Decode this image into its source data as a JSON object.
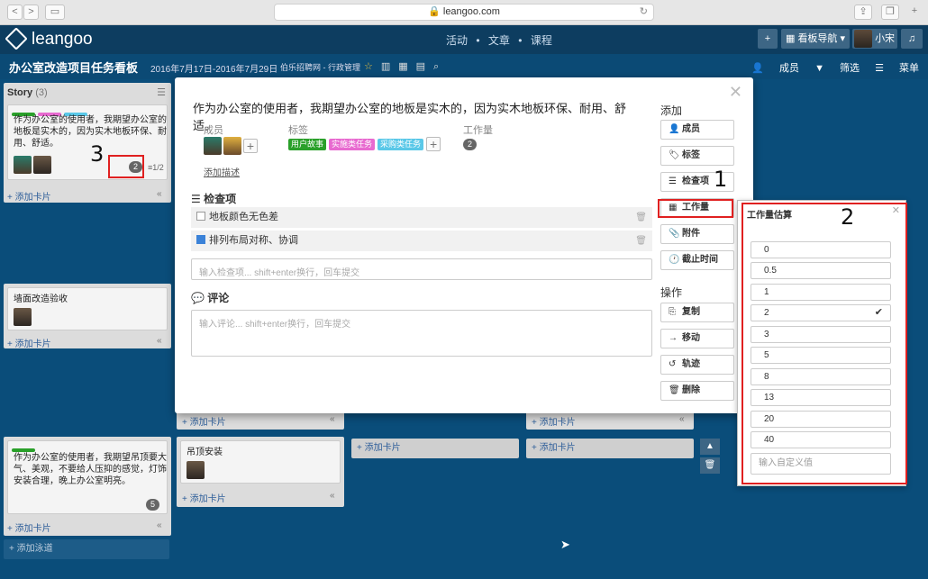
{
  "browser": {
    "url": "leangoo.com",
    "back": "<",
    "forward": ">",
    "reload": "↻"
  },
  "app": {
    "logo": "leangoo",
    "nav": [
      "活动",
      "•",
      "文章",
      "•",
      "课程"
    ],
    "add": "+",
    "board_nav": "看板导航 ▾",
    "user": "小宋",
    "bell": "🔔"
  },
  "board": {
    "title": "办公室改造项目任务看板",
    "dates": "2016年7月17日-2016年7月29日",
    "org": "伯乐招聘网 - 行政管理",
    "star": "☆",
    "tools": "▥▦▤⌕",
    "members": "成员",
    "filter": "筛选",
    "menu": "菜单"
  },
  "columns": {
    "story_title": "Story",
    "story_count": "(3)",
    "card1_text": "作为办公室的使用者，我期望办公室的地板是实木的，因为实木地板环保、耐用、舒适。",
    "card1_badge": "2",
    "card1_check": "≡1/2",
    "card2_text": "墙面改造验收",
    "card3_text": "作为办公室的使用者，我期望吊顶要大气、美观，不要给人压抑的感觉，灯饰安装合理，晚上办公室明亮。",
    "card3_badge": "5",
    "card4_text": "吊顶安装",
    "add_card": "+ 添加卡片",
    "add_lane": "+ 添加泳道",
    "collapse": "«"
  },
  "modal": {
    "title": "作为办公室的使用者，我期望办公室的地板是实木的，因为实木地板环保、耐用、舒适。",
    "close": "✕",
    "members_label": "成员",
    "tags_label": "标签",
    "workload_label": "工作量",
    "workload_value": "2",
    "tags": [
      {
        "text": "用户故事",
        "color": "#2aa02a"
      },
      {
        "text": "实施类任务",
        "color": "#e86ad0"
      },
      {
        "text": "采购类任务",
        "color": "#5ac8e8"
      }
    ],
    "add_desc": "添加描述",
    "checklist_title": "检查项",
    "check_items": [
      "地板颜色无色差",
      "排列布局对称、协调"
    ],
    "check_placeholder": "输入检查项... shift+enter换行，回车提交",
    "comments_title": "评论",
    "comment_placeholder": "输入评论... shift+enter换行，回车提交",
    "side_add": "添加",
    "side_ops": "操作",
    "btn_members": "成员",
    "btn_tags": "标签",
    "btn_checklist": "检查项",
    "btn_workload": "工作量",
    "btn_attach": "附件",
    "btn_due": "截止时间",
    "btn_copy": "复制",
    "btn_move": "移动",
    "btn_track": "轨迹",
    "btn_delete": "删除"
  },
  "estimate": {
    "title": "工作量估算",
    "close": "✕",
    "options": [
      "0",
      "0.5",
      "1",
      "2",
      "3",
      "5",
      "8",
      "13",
      "20",
      "40"
    ],
    "selected": "2",
    "check": "✔",
    "custom_placeholder": "输入自定义值"
  },
  "annotations": [
    "1",
    "2",
    "3"
  ],
  "colors": {
    "accent_red": "#e02020",
    "header_bg": "#0d3d60",
    "board_bg": "#0a4d7a"
  }
}
